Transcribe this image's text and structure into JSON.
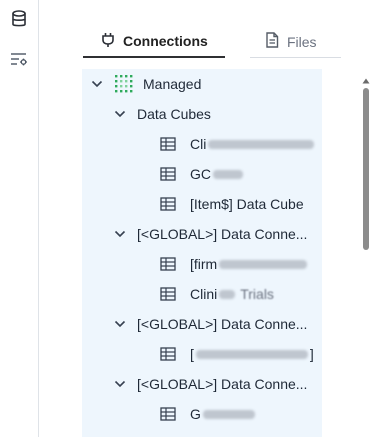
{
  "tabs": [
    {
      "label": "Connections",
      "icon": "plug-icon",
      "active": true
    },
    {
      "label": "Files",
      "icon": "file-icon",
      "active": false
    }
  ],
  "rail": {
    "icons": [
      "database-icon",
      "filter-settings-icon"
    ]
  },
  "tree": {
    "root": {
      "label": "Managed",
      "icon": "managed-grid-icon"
    },
    "groups": [
      {
        "label": "Data Cubes",
        "items": [
          {
            "label_visible": "Cli",
            "obscured": true
          },
          {
            "label_visible": "GC",
            "obscured": true
          },
          {
            "label_visible": "[Item$] Data Cube",
            "obscured": false
          }
        ]
      },
      {
        "label": "[<GLOBAL>] Data Conne...",
        "items": [
          {
            "label_visible": "[firm",
            "obscured": true
          },
          {
            "label_visible": "Clini",
            "obscured": true,
            "label_tail": "Trials"
          }
        ]
      },
      {
        "label": "[<GLOBAL>] Data Conne...",
        "items": [
          {
            "label_visible": "[",
            "obscured": true,
            "label_tail": "]"
          }
        ]
      },
      {
        "label": "[<GLOBAL>] Data Conne...",
        "items": [
          {
            "label_visible": "G",
            "obscured": true
          }
        ]
      }
    ]
  },
  "colors": {
    "tree_background": "#eef6fd",
    "accent_green": "#2faa5c",
    "scrollbar": "#8c8c8c"
  }
}
